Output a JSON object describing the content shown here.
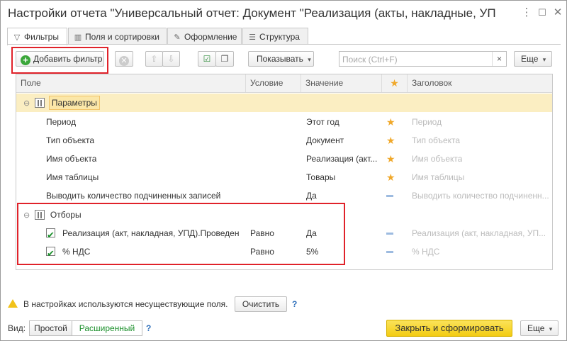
{
  "window": {
    "title": "Настройки отчета \"Универсальный отчет: Документ \"Реализация (акты, накладные, УП...",
    "more_icon": "more-vertical-icon",
    "maximize_icon": "maximize-icon",
    "close_icon": "close-icon"
  },
  "tabs": [
    {
      "label": "Фильтры",
      "icon": "filter-icon",
      "active": true
    },
    {
      "label": "Поля и сортировки",
      "icon": "fields-icon",
      "active": false
    },
    {
      "label": "Оформление",
      "icon": "brush-icon",
      "active": false
    },
    {
      "label": "Структура",
      "icon": "structure-icon",
      "active": false
    }
  ],
  "toolbar": {
    "add_filter": "Добавить фильтр",
    "show": "Показывать",
    "search_placeholder": "Поиск (Ctrl+F)",
    "more": "Еще"
  },
  "table": {
    "columns": [
      "Поле",
      "Условие",
      "Значение",
      "★",
      "Заголовок"
    ],
    "groups": [
      {
        "label": "Параметры",
        "rows": [
          {
            "field": "Период",
            "condition": "",
            "value": "Этот год",
            "mark": "star",
            "heading": "Период"
          },
          {
            "field": "Тип объекта",
            "condition": "",
            "value": "Документ",
            "mark": "star",
            "heading": "Тип объекта"
          },
          {
            "field": "Имя объекта",
            "condition": "",
            "value": "Реализация (акт...",
            "mark": "star",
            "heading": "Имя объекта"
          },
          {
            "field": "Имя таблицы",
            "condition": "",
            "value": "Товары",
            "mark": "star",
            "heading": "Имя таблицы"
          },
          {
            "field": "Выводить количество подчиненных записей",
            "condition": "",
            "value": "Да",
            "mark": "dash",
            "heading": "Выводить количество подчиненн..."
          }
        ]
      },
      {
        "label": "Отборы",
        "rows": [
          {
            "field": "Реализация (акт, накладная, УПД).Проведен",
            "condition": "Равно",
            "value": "Да",
            "mark": "dash",
            "heading": "Реализация (акт, накладная, УП...",
            "checked": true
          },
          {
            "field": "% НДС",
            "condition": "Равно",
            "value": "5%",
            "mark": "dash",
            "heading": "% НДС",
            "checked": true
          }
        ]
      }
    ]
  },
  "footer": {
    "warning": "В настройках используются несуществующие поля.",
    "clear": "Очистить",
    "help": "?",
    "view_label": "Вид:",
    "view_simple": "Простой",
    "view_extended": "Расширенный",
    "close_and_build": "Закрыть и сформировать",
    "more": "Еще"
  },
  "colors": {
    "primary_button": "#f3cc13",
    "highlight_row": "#fbeec2",
    "annotation_red": "#e0222a",
    "star": "#f0a82a",
    "check": "#1a8f2a"
  }
}
